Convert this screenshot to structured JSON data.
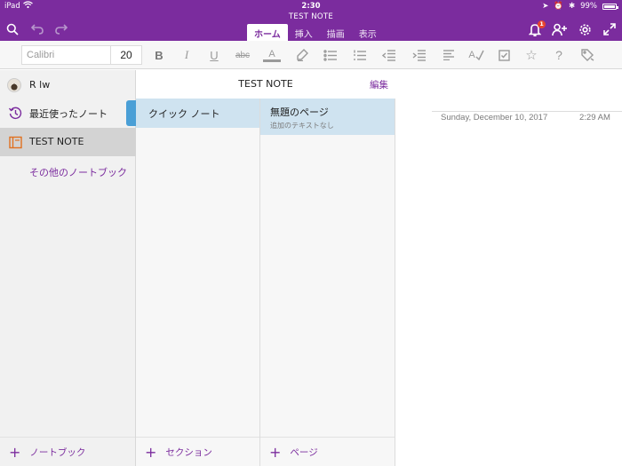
{
  "status_bar": {
    "device": "iPad",
    "time": "2:30",
    "battery": "99%"
  },
  "document_title": "TEST NOTE",
  "ribbon_tabs": [
    {
      "label": "ホーム",
      "active": true
    },
    {
      "label": "挿入",
      "active": false
    },
    {
      "label": "描画",
      "active": false
    },
    {
      "label": "表示",
      "active": false
    }
  ],
  "notifications": {
    "badge_count": "1"
  },
  "toolbar": {
    "font_name": "Calibri",
    "font_size": "20",
    "icons": [
      "bold-icon",
      "italic-icon",
      "underline-icon",
      "strikethrough-icon",
      "font-color-icon",
      "highlight-icon",
      "bullet-list-icon",
      "numbered-list-icon",
      "outdent-icon",
      "indent-icon",
      "align-icon",
      "spellcheck-icon",
      "checkbox-tag-icon",
      "star-tag-icon",
      "question-tag-icon",
      "tag-more-icon"
    ]
  },
  "notebooks": {
    "user_name": "R lw",
    "items": [
      {
        "label": "最近使ったノート",
        "icon": "recent-clock-icon"
      },
      {
        "label": "TEST NOTE",
        "icon": "notebook-icon",
        "selected": true
      },
      {
        "label": "その他のノートブック",
        "icon": ""
      }
    ],
    "add_label": "ノートブック"
  },
  "sections_header": {
    "title": "TEST NOTE",
    "edit_label": "編集"
  },
  "sections": {
    "items": [
      {
        "label": "クイック ノート",
        "color": "#4a9fd6"
      }
    ],
    "add_label": "セクション"
  },
  "pages": {
    "items": [
      {
        "title": "無題のページ",
        "preview": "追加のテキストなし"
      }
    ],
    "add_label": "ページ"
  },
  "canvas": {
    "date": "Sunday, December 10, 2017",
    "time": "2:29 AM"
  },
  "colors": {
    "accent": "#7B2C9E",
    "selection": "#cfe3f0",
    "section_tab": "#4a9fd6",
    "notebook_icon": "#e07020"
  }
}
